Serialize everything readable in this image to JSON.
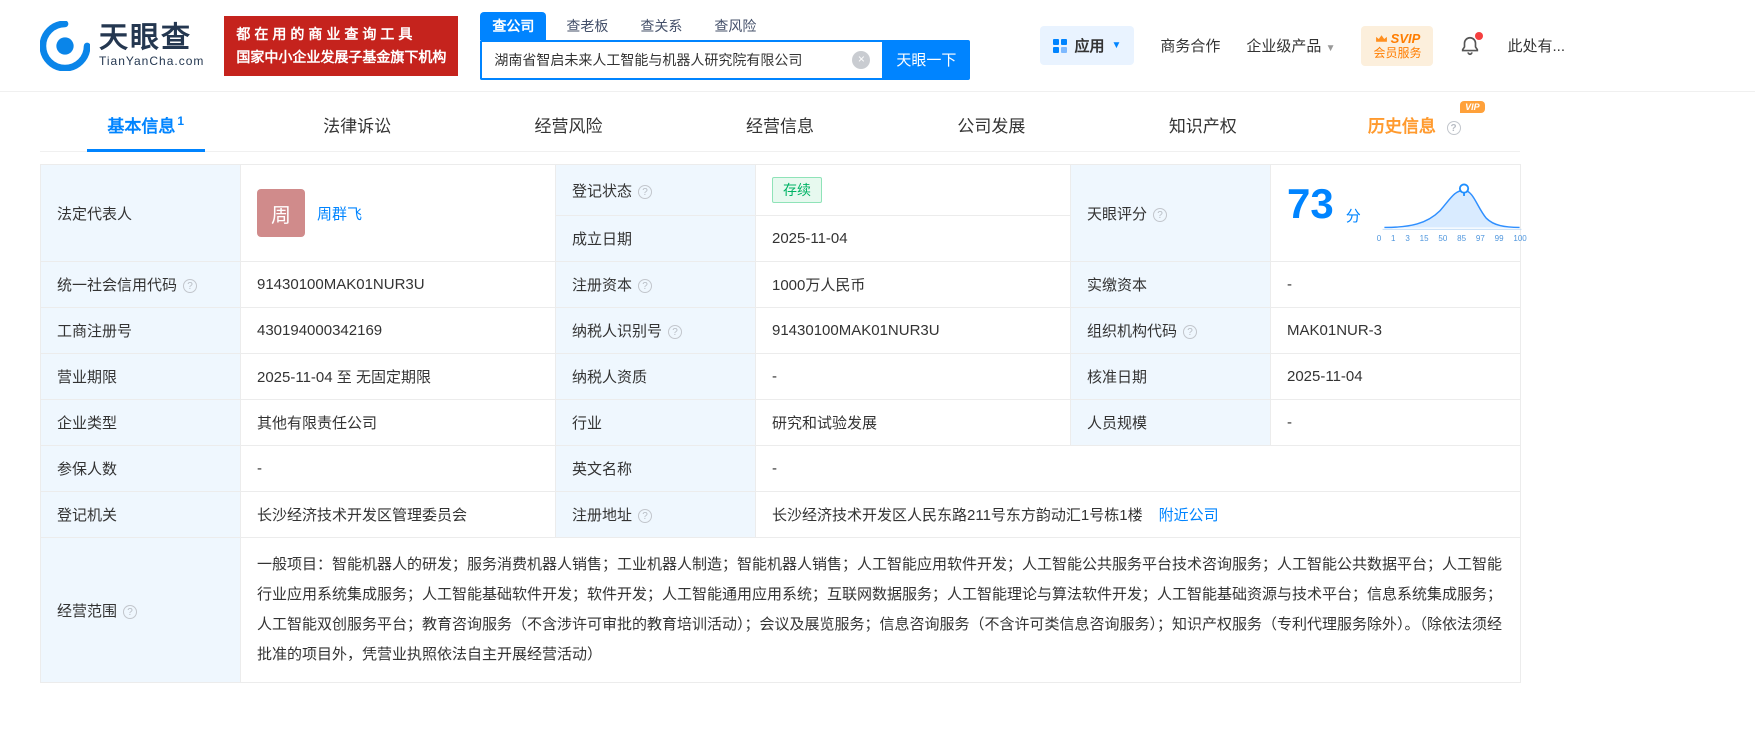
{
  "header": {
    "brand": "天眼查",
    "domain": "TianYanCha.com",
    "slogan1": "都在用的商业查询工具",
    "slogan2": "国家中小企业发展子基金旗下机构",
    "search_tabs": [
      "查公司",
      "查老板",
      "查关系",
      "查风险"
    ],
    "search": {
      "value": "湖南省智启未来人工智能与机器人研究院有限公司",
      "button": "天眼一下"
    },
    "nav": {
      "app": "应用",
      "biz": "商务合作",
      "enterprise": "企业级产品",
      "svip_top": "SVIP",
      "svip_bottom": "会员服务",
      "user": "此处有..."
    },
    "colors": {
      "brand_blue": "#0084ff",
      "banner_red": "#c5231d",
      "vip_orange": "#ff9a2e",
      "status_green": "#00b365"
    }
  },
  "tabs": [
    {
      "label": "基本信息",
      "badge": "1"
    },
    {
      "label": "法律诉讼"
    },
    {
      "label": "经营风险"
    },
    {
      "label": "经营信息"
    },
    {
      "label": "公司发展"
    },
    {
      "label": "知识产权"
    },
    {
      "label": "历史信息",
      "vip": "VIP"
    }
  ],
  "table": {
    "legal_rep": {
      "label": "法定代表人",
      "avatar": "周",
      "name": "周群飞"
    },
    "reg_status": {
      "label": "登记状态",
      "value": "存续"
    },
    "establish_date": {
      "label": "成立日期",
      "value": "2025-11-04"
    },
    "score": {
      "label": "天眼评分",
      "value": "73",
      "unit": "分",
      "axis": [
        "0",
        "1",
        "3",
        "15",
        "50",
        "85",
        "97",
        "99",
        "100"
      ]
    },
    "credit_code": {
      "label": "统一社会信用代码",
      "value": "91430100MAK01NUR3U"
    },
    "reg_capital": {
      "label": "注册资本",
      "value": "1000万人民币"
    },
    "paid_capital": {
      "label": "实缴资本",
      "value": "-"
    },
    "reg_number": {
      "label": "工商注册号",
      "value": "430194000342169"
    },
    "taxpayer_id": {
      "label": "纳税人识别号",
      "value": "91430100MAK01NUR3U"
    },
    "org_code": {
      "label": "组织机构代码",
      "value": "MAK01NUR-3"
    },
    "business_term": {
      "label": "营业期限",
      "value": "2025-11-04 至 无固定期限"
    },
    "taxpayer_qualification": {
      "label": "纳税人资质",
      "value": "-"
    },
    "approval_date": {
      "label": "核准日期",
      "value": "2025-11-04"
    },
    "company_type": {
      "label": "企业类型",
      "value": "其他有限责任公司"
    },
    "industry": {
      "label": "行业",
      "value": "研究和试验发展"
    },
    "staff_size": {
      "label": "人员规模",
      "value": "-"
    },
    "insured_count": {
      "label": "参保人数",
      "value": "-"
    },
    "english_name": {
      "label": "英文名称",
      "value": "-"
    },
    "reg_authority": {
      "label": "登记机关",
      "value": "长沙经济技术开发区管理委员会"
    },
    "reg_address": {
      "label": "注册地址",
      "value": "长沙经济技术开发区人民东路211号东方韵动汇1号栋1楼",
      "nearby_link": "附近公司"
    },
    "business_scope": {
      "label": "经营范围",
      "value": "一般项目：智能机器人的研发；服务消费机器人销售；工业机器人制造；智能机器人销售；人工智能应用软件开发；人工智能公共服务平台技术咨询服务；人工智能公共数据平台；人工智能行业应用系统集成服务；人工智能基础软件开发；软件开发；人工智能通用应用系统；互联网数据服务；人工智能理论与算法软件开发；人工智能基础资源与技术平台；信息系统集成服务；人工智能双创服务平台；教育咨询服务（不含涉许可审批的教育培训活动）；会议及展览服务；信息咨询服务（不含许可类信息咨询服务）；知识产权服务（专利代理服务除外）。（除依法须经批准的项目外，凭营业执照依法自主开展经营活动）"
    }
  }
}
